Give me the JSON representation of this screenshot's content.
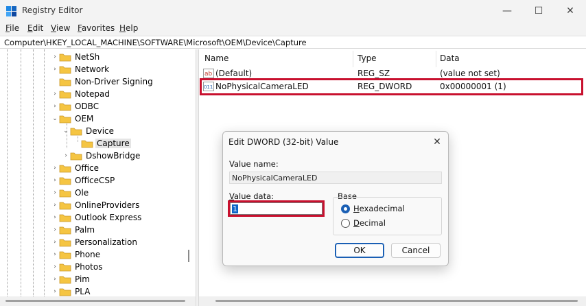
{
  "window": {
    "title": "Registry Editor",
    "icon": "registry-icon"
  },
  "window_controls": {
    "minimize": "—",
    "maximize": "☐",
    "close": "✕"
  },
  "menu": [
    {
      "mnemonic": "F",
      "rest": "ile"
    },
    {
      "mnemonic": "E",
      "rest": "dit"
    },
    {
      "mnemonic": "V",
      "rest": "iew"
    },
    {
      "mnemonic": "F",
      "rest": "avorites"
    },
    {
      "mnemonic": "H",
      "rest": "elp"
    }
  ],
  "address": "Computer\\HKEY_LOCAL_MACHINE\\SOFTWARE\\Microsoft\\OEM\\Device\\Capture",
  "tree": {
    "items": [
      {
        "label": "NetSh"
      },
      {
        "label": "Network"
      },
      {
        "label": "Non-Driver Signing"
      },
      {
        "label": "Notepad"
      },
      {
        "label": "ODBC"
      },
      {
        "label": "OEM"
      },
      {
        "label": "Device"
      },
      {
        "label": "Capture"
      },
      {
        "label": "DshowBridge"
      },
      {
        "label": "Office"
      },
      {
        "label": "OfficeCSP"
      },
      {
        "label": "Ole"
      },
      {
        "label": "OnlineProviders"
      },
      {
        "label": "Outlook Express"
      },
      {
        "label": "Palm"
      },
      {
        "label": "Personalization"
      },
      {
        "label": "Phone"
      },
      {
        "label": "Photos"
      },
      {
        "label": "Pim"
      },
      {
        "label": "PLA"
      }
    ],
    "selected": "Capture"
  },
  "list": {
    "columns": {
      "name": "Name",
      "type": "Type",
      "data": "Data"
    },
    "rows": [
      {
        "icon": "string-value-icon",
        "glyph": "ab",
        "name": "(Default)",
        "type": "REG_SZ",
        "data": "(value not set)"
      },
      {
        "icon": "binary-value-icon",
        "glyph": "011",
        "name": "NoPhysicalCameraLED",
        "type": "REG_DWORD",
        "data": "0x00000001 (1)"
      }
    ]
  },
  "dialog": {
    "title": "Edit DWORD (32-bit) Value",
    "close": "✕",
    "value_name_label": {
      "mnemonic": "",
      "text": "Value name:"
    },
    "value_name": "NoPhysicalCameraLED",
    "value_data_label": {
      "mnemonic": "V",
      "rest": "alue data:"
    },
    "value_data": "1",
    "base_label": "Base",
    "base_options": [
      {
        "mnemonic": "H",
        "rest": "exadecimal",
        "checked": true
      },
      {
        "mnemonic": "D",
        "rest": "ecimal",
        "checked": false
      }
    ],
    "ok": "OK",
    "cancel": "Cancel"
  },
  "colors": {
    "highlight": "#c8102e",
    "accent": "#1a5fb4",
    "folder": "#f5c542"
  }
}
